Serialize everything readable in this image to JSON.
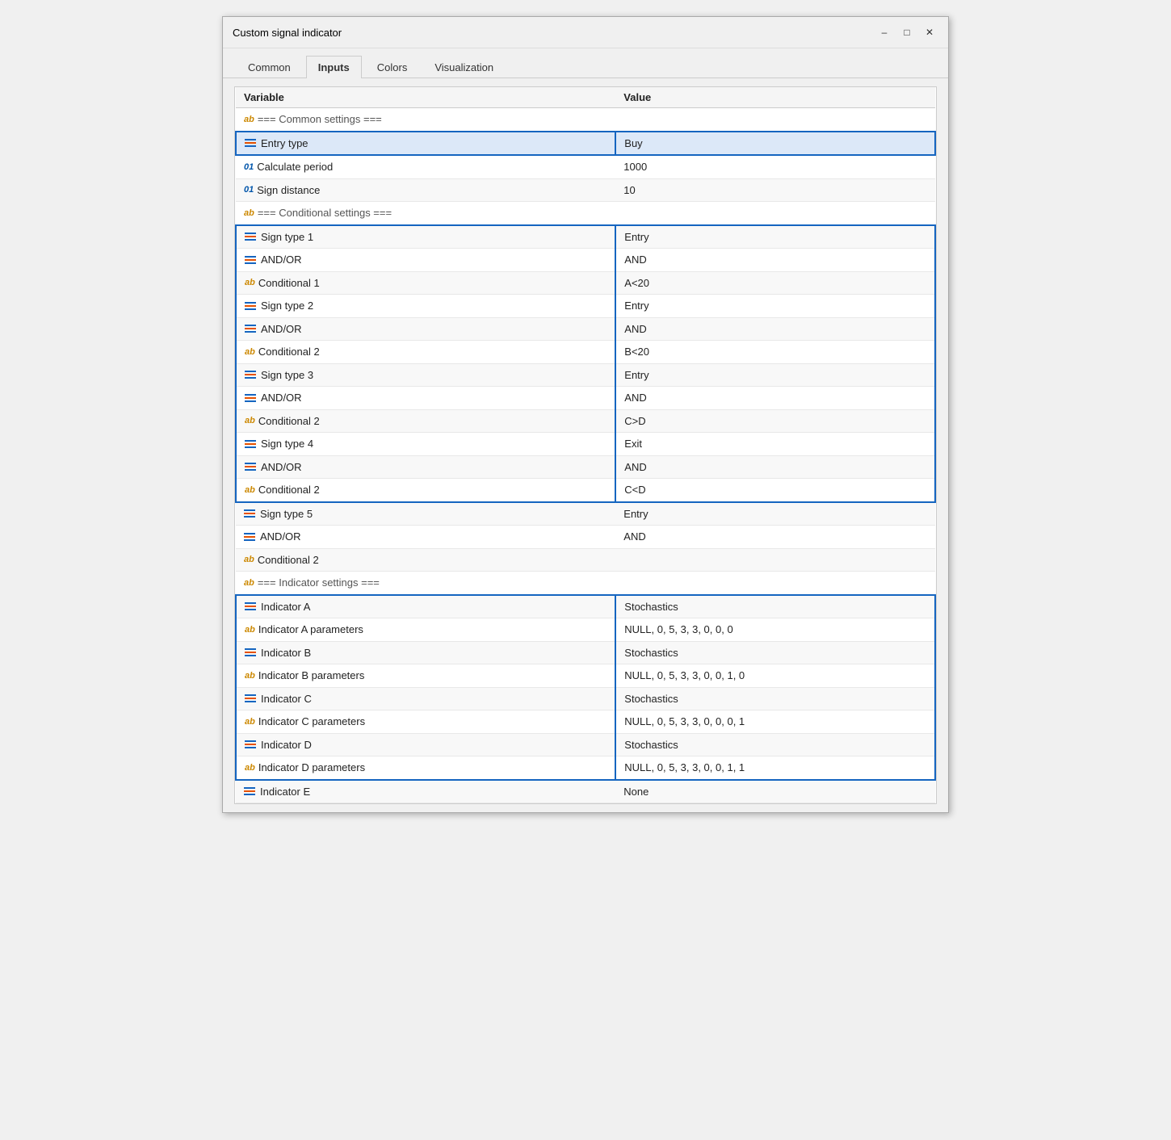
{
  "window": {
    "title": "Custom signal indicator",
    "controls": {
      "minimize": "–",
      "maximize": "□",
      "close": "✕"
    }
  },
  "tabs": [
    {
      "id": "common",
      "label": "Common",
      "active": false
    },
    {
      "id": "inputs",
      "label": "Inputs",
      "active": true
    },
    {
      "id": "colors",
      "label": "Colors",
      "active": false
    },
    {
      "id": "visualization",
      "label": "Visualization",
      "active": false
    }
  ],
  "table": {
    "headers": [
      "Variable",
      "Value"
    ],
    "rows": [
      {
        "id": "header-common",
        "iconType": "ab",
        "variable": " === Common settings ===",
        "value": "",
        "sectionHeader": true,
        "selGroup": null
      },
      {
        "id": "entry-type",
        "iconType": "list-blue",
        "variable": "Entry type",
        "value": "Buy",
        "selGroup": "A",
        "selPos": "single",
        "highlight": true
      },
      {
        "id": "calc-period",
        "iconType": "01",
        "variable": "Calculate period",
        "value": "1000",
        "selGroup": null
      },
      {
        "id": "sign-dist",
        "iconType": "01",
        "variable": "Sign distance",
        "value": "10",
        "selGroup": null
      },
      {
        "id": "header-cond",
        "iconType": "ab",
        "variable": " === Conditional settings ===",
        "value": "",
        "sectionHeader": true,
        "selGroup": null
      },
      {
        "id": "sign-type-1",
        "iconType": "list-blue",
        "variable": "Sign type 1",
        "value": "Entry",
        "selGroup": "B",
        "selPos": "top"
      },
      {
        "id": "and-or-1",
        "iconType": "list-blue",
        "variable": "AND/OR",
        "value": "AND",
        "selGroup": "B"
      },
      {
        "id": "cond-1",
        "iconType": "ab",
        "variable": "Conditional 1",
        "value": "A<20",
        "selGroup": "B"
      },
      {
        "id": "sign-type-2",
        "iconType": "list-blue",
        "variable": "Sign type 2",
        "value": "Entry",
        "selGroup": "B"
      },
      {
        "id": "and-or-2",
        "iconType": "list-blue",
        "variable": "AND/OR",
        "value": "AND",
        "selGroup": "B"
      },
      {
        "id": "cond-2a",
        "iconType": "ab",
        "variable": "Conditional 2",
        "value": "B<20",
        "selGroup": "B"
      },
      {
        "id": "sign-type-3",
        "iconType": "list-blue",
        "variable": "Sign type 3",
        "value": "Entry",
        "selGroup": "B"
      },
      {
        "id": "and-or-3",
        "iconType": "list-blue",
        "variable": "AND/OR",
        "value": "AND",
        "selGroup": "B"
      },
      {
        "id": "cond-2b",
        "iconType": "ab",
        "variable": "Conditional 2",
        "value": "C>D",
        "selGroup": "B"
      },
      {
        "id": "sign-type-4",
        "iconType": "list-blue",
        "variable": "Sign type 4",
        "value": "Exit",
        "selGroup": "B"
      },
      {
        "id": "and-or-4",
        "iconType": "list-blue",
        "variable": "AND/OR",
        "value": "AND",
        "selGroup": "B"
      },
      {
        "id": "cond-2c",
        "iconType": "ab",
        "variable": "Conditional 2",
        "value": "C<D",
        "selGroup": "B",
        "selPos": "bottom"
      },
      {
        "id": "sign-type-5",
        "iconType": "list-blue",
        "variable": "Sign type 5",
        "value": "Entry",
        "selGroup": null
      },
      {
        "id": "and-or-5",
        "iconType": "list-blue",
        "variable": "AND/OR",
        "value": "AND",
        "selGroup": null
      },
      {
        "id": "cond-2d",
        "iconType": "ab",
        "variable": "Conditional 2",
        "value": "",
        "selGroup": null
      },
      {
        "id": "header-ind",
        "iconType": "ab",
        "variable": " === Indicator settings ===",
        "value": "",
        "sectionHeader": true,
        "selGroup": null
      },
      {
        "id": "ind-a",
        "iconType": "list-blue",
        "variable": "Indicator A",
        "value": "Stochastics",
        "selGroup": "C",
        "selPos": "top"
      },
      {
        "id": "ind-a-params",
        "iconType": "ab",
        "variable": "Indicator A parameters",
        "value": "NULL, 0, 5, 3, 3, 0, 0, 0",
        "selGroup": "C"
      },
      {
        "id": "ind-b",
        "iconType": "list-blue",
        "variable": "Indicator B",
        "value": "Stochastics",
        "selGroup": "C"
      },
      {
        "id": "ind-b-params",
        "iconType": "ab",
        "variable": "Indicator B parameters",
        "value": "NULL, 0, 5, 3, 3, 0, 0, 1, 0",
        "selGroup": "C"
      },
      {
        "id": "ind-c",
        "iconType": "list-blue",
        "variable": "Indicator C",
        "value": "Stochastics",
        "selGroup": "C"
      },
      {
        "id": "ind-c-params",
        "iconType": "ab",
        "variable": "Indicator C parameters",
        "value": "NULL, 0, 5, 3, 3, 0, 0, 0, 1",
        "selGroup": "C"
      },
      {
        "id": "ind-d",
        "iconType": "list-blue",
        "variable": "Indicator D",
        "value": "Stochastics",
        "selGroup": "C"
      },
      {
        "id": "ind-d-params",
        "iconType": "ab",
        "variable": "Indicator D parameters",
        "value": "NULL, 0, 5, 3, 3, 0, 0, 1, 1",
        "selGroup": "C",
        "selPos": "bottom"
      },
      {
        "id": "ind-e",
        "iconType": "list-blue",
        "variable": "Indicator E",
        "value": "None",
        "selGroup": null
      }
    ]
  }
}
